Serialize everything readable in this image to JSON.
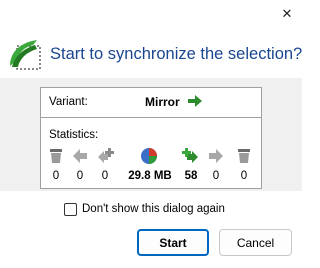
{
  "window": {
    "close_glyph": "✕"
  },
  "header": {
    "icon": "sync-logo-icon",
    "title": "Start to synchronize the selection?"
  },
  "variant": {
    "label": "Variant:",
    "value": "Mirror",
    "icon": "green-right-arrow-icon"
  },
  "statistics": {
    "label": "Statistics:",
    "items": [
      {
        "icon": "left-delete-icon",
        "value": "0"
      },
      {
        "icon": "left-update-icon",
        "value": "0"
      },
      {
        "icon": "left-create-icon",
        "value": "0"
      },
      {
        "icon": "data-pie-icon",
        "value": "29.8 MB"
      },
      {
        "icon": "right-create-icon",
        "value": "58"
      },
      {
        "icon": "right-update-icon",
        "value": "0"
      },
      {
        "icon": "right-delete-icon",
        "value": "0"
      }
    ]
  },
  "checkbox": {
    "label": "Don't show this dialog again",
    "checked": false
  },
  "buttons": {
    "start": "Start",
    "cancel": "Cancel"
  },
  "colors": {
    "title": "#1a4690",
    "accent": "#0067c0",
    "green": "#2e8b2e"
  }
}
